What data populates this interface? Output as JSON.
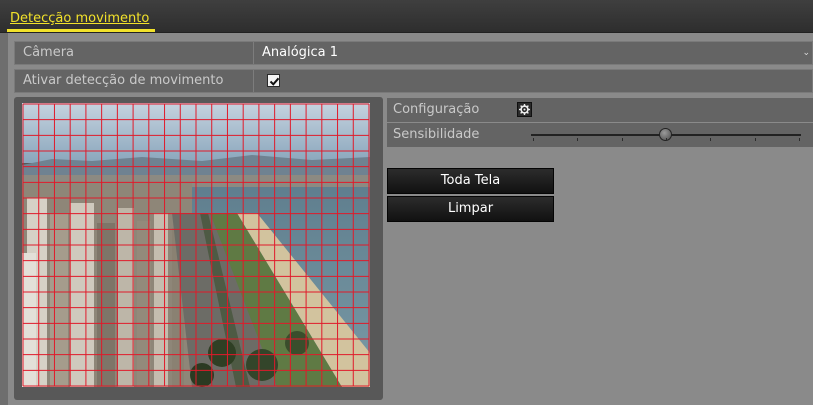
{
  "header": {
    "tab_title": "Detecção movimento"
  },
  "camera": {
    "label": "Câmera",
    "value": "Analógica 1"
  },
  "motion_detection": {
    "label": "Ativar detecção de movimento",
    "checked": true
  },
  "settings": {
    "config_label": "Configuração",
    "sensitivity_label": "Sensibilidade",
    "sensitivity_fraction": 0.5
  },
  "buttons": {
    "full_screen": "Toda Tela",
    "clear": "Limpar"
  },
  "grid": {
    "columns": 22,
    "rows": 18,
    "line_color": "#e01a2a"
  },
  "icons": {
    "checkbox": "checkmark-icon",
    "config": "gear-icon",
    "dropdown": "chevron-down-icon"
  }
}
